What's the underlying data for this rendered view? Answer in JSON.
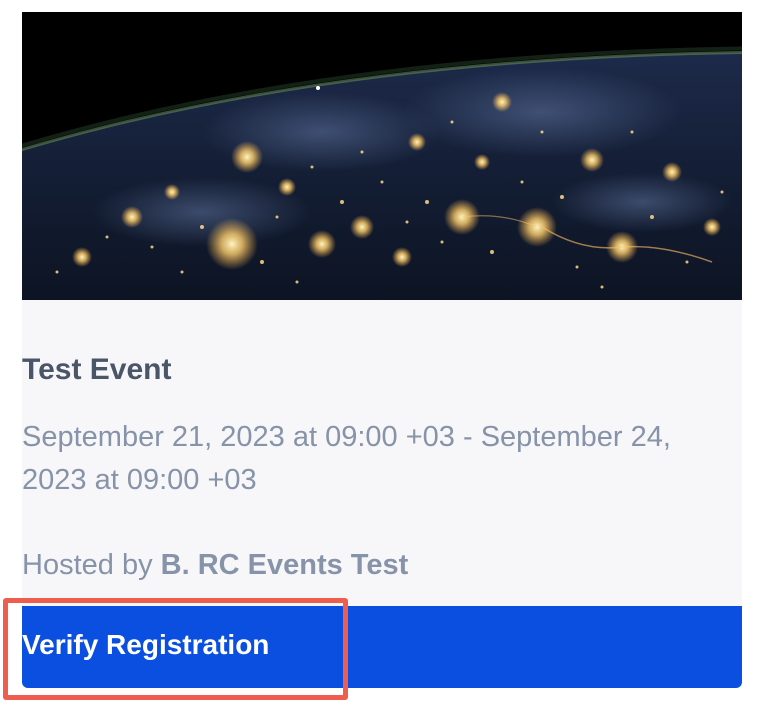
{
  "event": {
    "title": "Test Event",
    "dates": "September 21, 2023 at 09:00 +03 - September 24, 2023 at 09:00 +03",
    "host_prefix": "Hosted by ",
    "host_name": "B. RC Events Test",
    "hero_image": "earth-at-night-photo"
  },
  "actions": {
    "verify_label": "Verify Registration"
  },
  "colors": {
    "accent": "#0a4fe0",
    "highlight": "#ef5d4e",
    "card_background": "#f7f7fa",
    "title_text": "#4a5568",
    "muted_text": "#8793a8"
  }
}
